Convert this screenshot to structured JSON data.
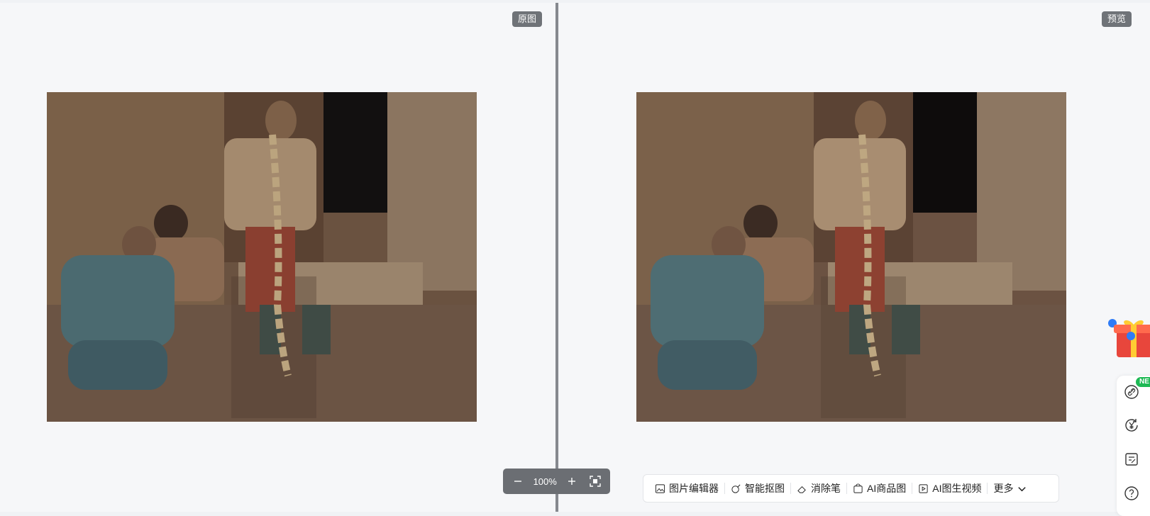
{
  "badges": {
    "original": "原图",
    "preview": "预览"
  },
  "zoom": {
    "value": "100%"
  },
  "toolbar": {
    "items": [
      {
        "label": "图片编辑器",
        "icon": "image-icon"
      },
      {
        "label": "智能抠图",
        "icon": "cutout-icon"
      },
      {
        "label": "消除笔",
        "icon": "eraser-icon"
      },
      {
        "label": "AI商品图",
        "icon": "bag-icon"
      },
      {
        "label": "AI图生视频",
        "icon": "video-icon"
      }
    ],
    "more": "更多"
  },
  "rail": {
    "new_badge": "NE",
    "icons": [
      "link-icon",
      "yuan-refresh-icon",
      "note-icon",
      "help-icon"
    ]
  },
  "colors": {
    "badge_bg": "#6f7378",
    "new_badge": "#1db954",
    "divider": "#86898f"
  }
}
